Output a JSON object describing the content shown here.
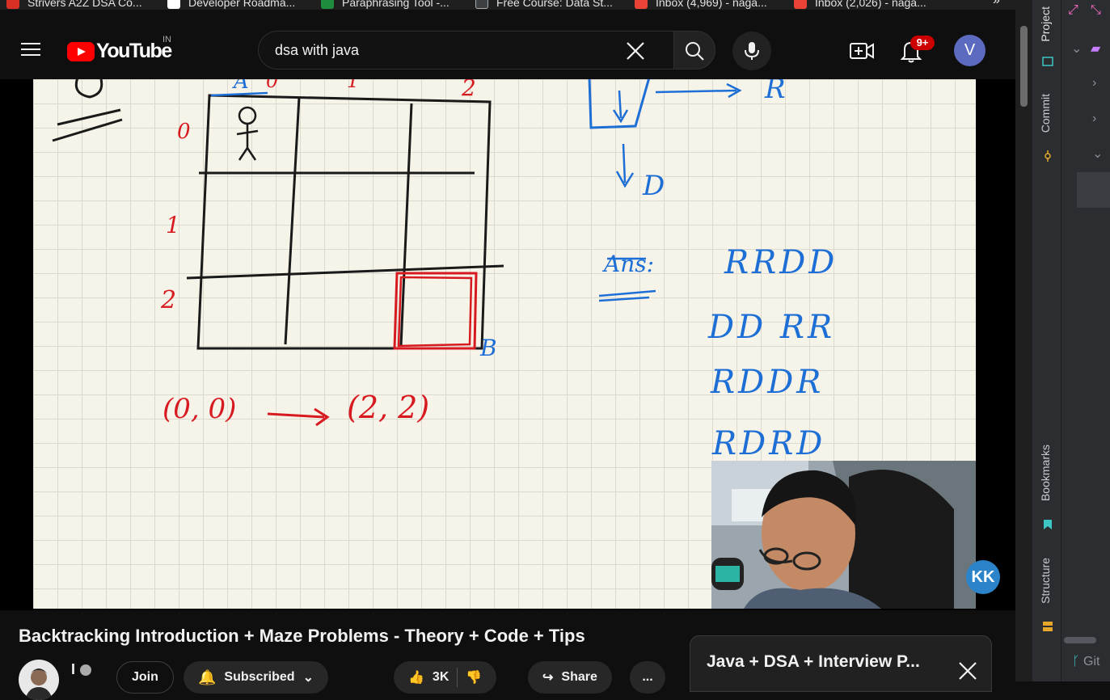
{
  "bookmarks": [
    {
      "label": "Strivers A2Z DSA Co...",
      "color": "#d93025"
    },
    {
      "label": "Developer Roadma...",
      "color": "#ffffff"
    },
    {
      "label": "Paraphrasing Tool -...",
      "color": "#1e8e3e"
    },
    {
      "label": "Free Course: Data St...",
      "color": "#3c4043"
    },
    {
      "label": "Inbox (4,969) - naga...",
      "color": "#ea4335"
    },
    {
      "label": "Inbox (2,026) - naga...",
      "color": "#ea4335"
    }
  ],
  "header": {
    "logo_text": "YouTube",
    "region": "IN",
    "search_value": "dsa with java",
    "notification_count": "9+",
    "avatar_letter": "V"
  },
  "whiteboard": {
    "start_label": "A",
    "end_label": "B",
    "col_labels": [
      "0",
      "1",
      "2"
    ],
    "row_labels": [
      "0",
      "1",
      "2"
    ],
    "from_coord": "(0, 0)",
    "arrow": "⟶",
    "to_coord": "(2, 2)",
    "right_label": "R",
    "down_label": "D",
    "ans_label": "Ans:",
    "answers": [
      "RRDD",
      "DD RR",
      "RDDR",
      "RDRD"
    ],
    "ink_colors": {
      "black": "#1a1a1a",
      "red": "#d71920",
      "blue": "#1d6fd6"
    }
  },
  "overlay": {
    "kk_label": "KK"
  },
  "video": {
    "title": "Backtracking Introduction + Maze Problems - Theory + Code + Tips",
    "channel_name": "I",
    "join_label": "Join",
    "subscribed_label": "Subscribed",
    "likes": "3K",
    "share_label": "Share",
    "more_label": "..."
  },
  "playlist": {
    "title": "Java + DSA + Interview P..."
  },
  "ide": {
    "tabs": [
      "Project",
      "Commit",
      "Bookmarks",
      "Structure"
    ],
    "git_label": "Git"
  }
}
